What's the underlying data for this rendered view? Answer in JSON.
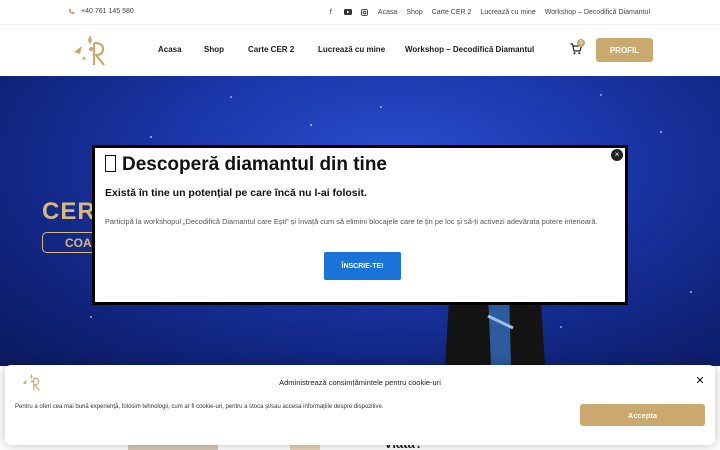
{
  "topbar": {
    "phone": "+40 761 145 580",
    "social": [
      "facebook-icon",
      "youtube-icon",
      "instagram-icon"
    ],
    "links": [
      "Acasa",
      "Shop",
      "Carte CER 2",
      "Lucrează cu mine",
      "Workshop – Decodifică Diamantul"
    ]
  },
  "header": {
    "nav": [
      "Acasa",
      "Shop",
      "Carte CER 2",
      "Lucrează cu mine",
      "Workshop – Decodifică Diamantul"
    ],
    "cart_count": "0",
    "profile_label": "PROFIL"
  },
  "hero": {
    "title_fragment": "CER",
    "pill_fragment": "COA"
  },
  "popup": {
    "heading": "Descoperă diamantul din tine",
    "subheading": "Există în tine un potențial pe care încă nu l-ai folosit.",
    "body": "Participă la workshopul „Decodifică Diamantul care Ești” și învață cum să elimini blocajele care te țin pe loc și să-ți activezi adevărata putere interioară.",
    "cta": "ÎNSCRIE-TE!",
    "close": "×"
  },
  "behind": {
    "word": "Viata?"
  },
  "cookie": {
    "title": "Administrează consimțămintele pentru cookie-uri",
    "text": "Pentru a oferi cea mai bună experiență, folosim tehnologii, cum ar fi cookie-uri, pentru a stoca și/sau accesa informațiile despre dispozitive.",
    "accept": "Accepta",
    "close": "✕"
  },
  "colors": {
    "gold": "#c9a96e",
    "hero_blue": "#1a36a8",
    "cta_blue": "#1a73d9"
  }
}
